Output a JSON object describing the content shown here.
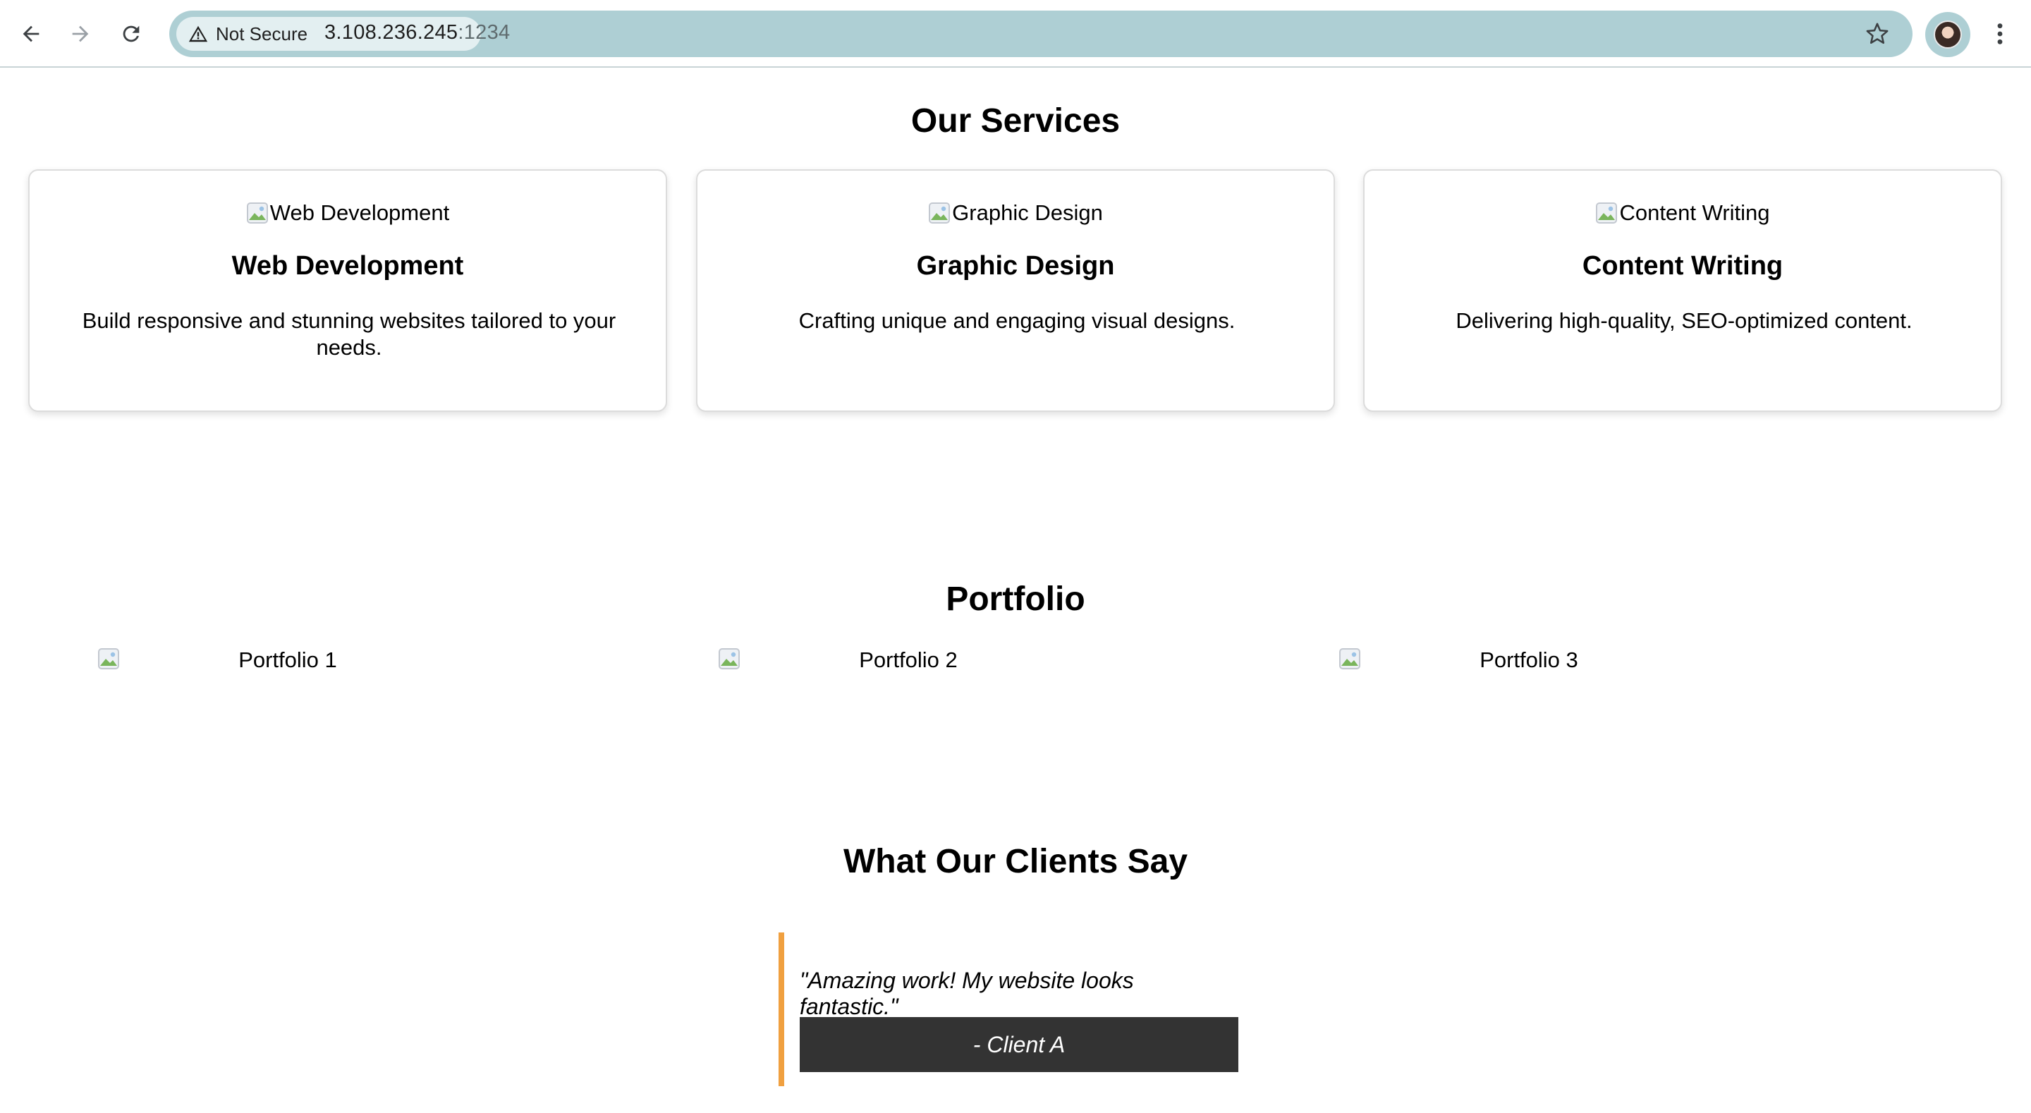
{
  "browser": {
    "security_label": "Not Secure",
    "url_host": "3.108.236.245",
    "url_port": ":1234"
  },
  "services": {
    "title": "Our Services",
    "cards": [
      {
        "img_alt": "Web Development",
        "title": "Web Development",
        "desc": "Build responsive and stunning websites tailored to your needs."
      },
      {
        "img_alt": "Graphic Design",
        "title": "Graphic Design",
        "desc": "Crafting unique and engaging visual designs."
      },
      {
        "img_alt": "Content Writing",
        "title": "Content Writing",
        "desc": "Delivering high-quality, SEO-optimized content."
      }
    ]
  },
  "portfolio": {
    "title": "Portfolio",
    "items": [
      {
        "alt": "Portfolio 1"
      },
      {
        "alt": "Portfolio 2"
      },
      {
        "alt": "Portfolio 3"
      }
    ]
  },
  "testimonials": {
    "title": "What Our Clients Say",
    "quote": "\"Amazing work! My website looks fantastic.\"",
    "client": "- Client A"
  },
  "colors": {
    "omnibox": "#aecfd4",
    "accent_border": "#f0a040",
    "client_bar": "#333333"
  }
}
